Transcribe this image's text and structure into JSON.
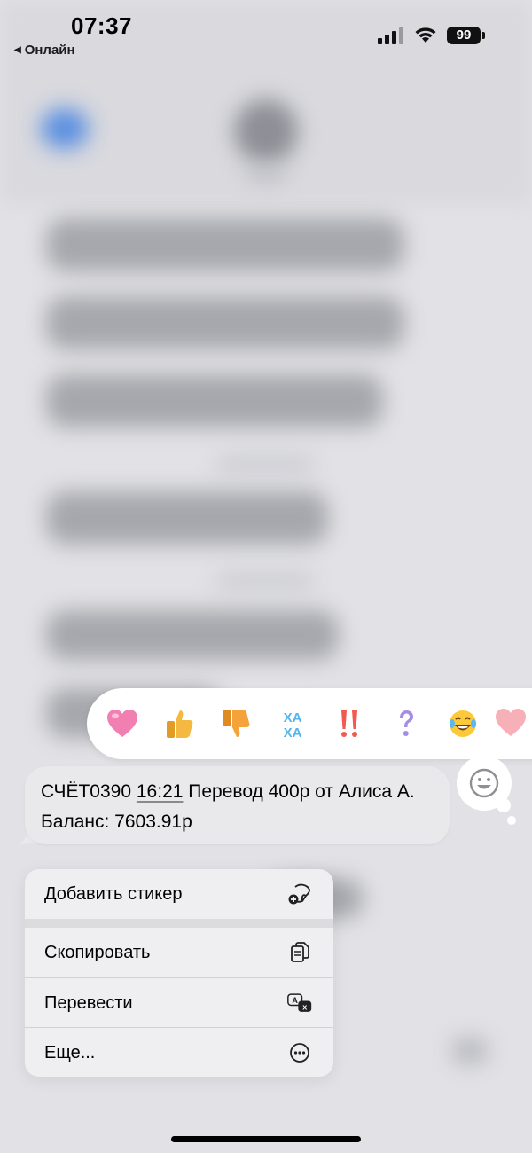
{
  "status_bar": {
    "time": "07:37",
    "back_app": "Онлайн",
    "battery": "99"
  },
  "reactions": [
    {
      "icon": "pink-heart-icon",
      "name": "heart"
    },
    {
      "icon": "thumbs-up-icon",
      "name": "thumbs-up"
    },
    {
      "icon": "thumbs-down-icon",
      "name": "thumbs-down"
    },
    {
      "icon": "haha-icon",
      "name": "haha",
      "text": "ХА ХА"
    },
    {
      "icon": "double-exclamation-icon",
      "name": "exclamation"
    },
    {
      "icon": "question-icon",
      "name": "question"
    },
    {
      "icon": "tears-of-joy-icon",
      "name": "laugh"
    },
    {
      "icon": "partial-heart-icon",
      "name": "more"
    }
  ],
  "message": {
    "prefix": "СЧЁТ0390 ",
    "time_link": "16:21",
    "rest": " Перевод 400р от Алиса А. Баланс: 7603.91р"
  },
  "menu": {
    "items": [
      {
        "label": "Добавить стикер",
        "icon": "sticker-add-icon"
      },
      {
        "label": "Скопировать",
        "icon": "copy-icon"
      },
      {
        "label": "Перевести",
        "icon": "translate-icon"
      },
      {
        "label": "Еще...",
        "icon": "more-ellipsis-icon"
      }
    ]
  },
  "colors": {
    "background": "#e2e2e6",
    "bubble": "#e9e9eb",
    "menu": "#efeff1",
    "reaction_bar": "#ffffff"
  }
}
